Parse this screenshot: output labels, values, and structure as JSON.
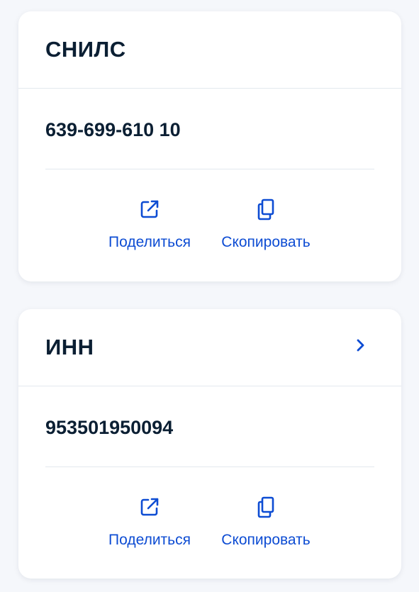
{
  "cards": [
    {
      "title": "СНИЛС",
      "value": "639-699-610 10",
      "has_chevron": false,
      "actions": {
        "share_label": "Поделиться",
        "copy_label": "Скопировать"
      }
    },
    {
      "title": "ИНН",
      "value": "953501950094",
      "has_chevron": true,
      "actions": {
        "share_label": "Поделиться",
        "copy_label": "Скопировать"
      }
    }
  ],
  "colors": {
    "accent": "#0d4cd3",
    "text": "#0b1f33",
    "background": "#f5f7fb",
    "card": "#ffffff",
    "divider": "#e3e8ee"
  },
  "icons": {
    "share": "share-icon",
    "copy": "copy-icon",
    "chevron": "chevron-right-icon"
  }
}
